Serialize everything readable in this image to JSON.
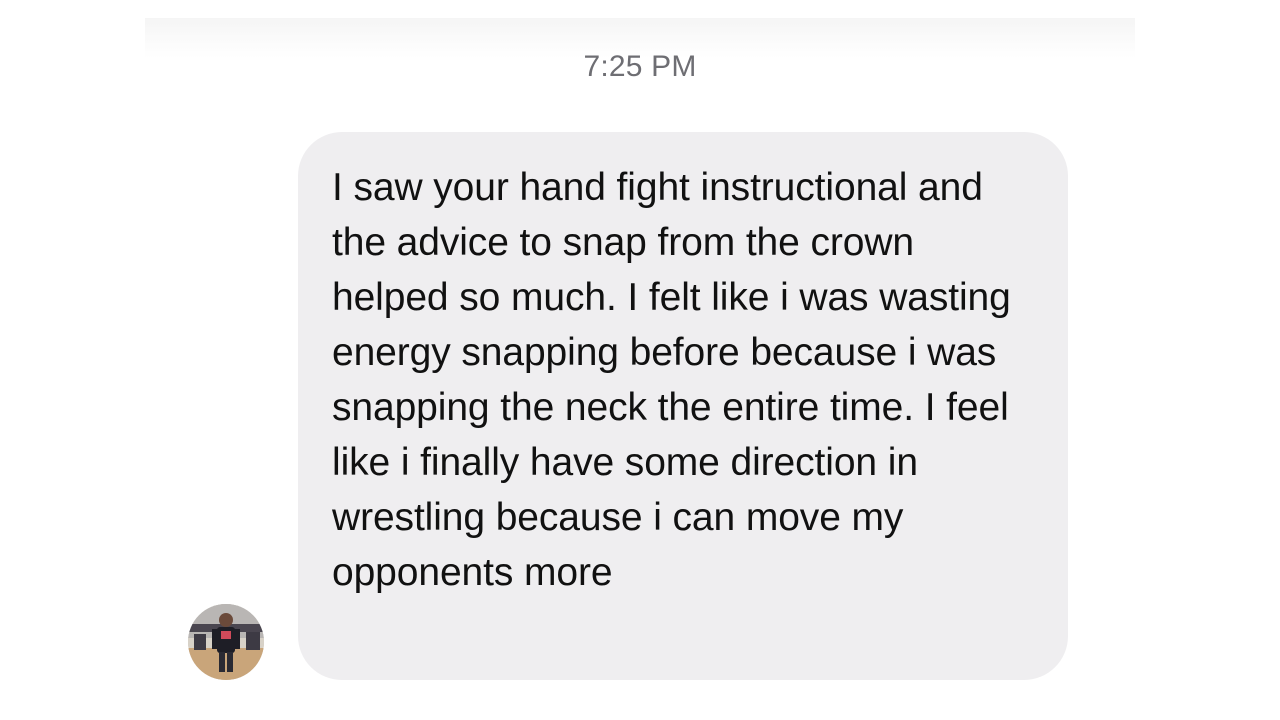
{
  "conversation": {
    "timestamp": "7:25 PM",
    "message": {
      "text": "I saw your hand fight instructional and the advice to snap from the crown helped so much. I felt like i was wasting energy snapping before because i was snapping the neck the entire time. I feel like i finally have some direction in wrestling because i can move my opponents more"
    },
    "sender_avatar_icon": "user-avatar-photo"
  },
  "colors": {
    "bubble": "#efeef0",
    "text": "#111111",
    "timestamp": "#6e6e73",
    "background": "#ffffff"
  }
}
